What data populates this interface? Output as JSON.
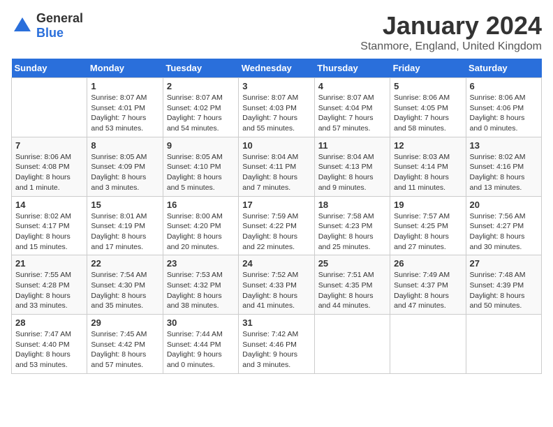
{
  "header": {
    "logo_general": "General",
    "logo_blue": "Blue",
    "month_title": "January 2024",
    "location": "Stanmore, England, United Kingdom"
  },
  "days_of_week": [
    "Sunday",
    "Monday",
    "Tuesday",
    "Wednesday",
    "Thursday",
    "Friday",
    "Saturday"
  ],
  "weeks": [
    [
      {
        "day": "",
        "info": ""
      },
      {
        "day": "1",
        "info": "Sunrise: 8:07 AM\nSunset: 4:01 PM\nDaylight: 7 hours\nand 53 minutes."
      },
      {
        "day": "2",
        "info": "Sunrise: 8:07 AM\nSunset: 4:02 PM\nDaylight: 7 hours\nand 54 minutes."
      },
      {
        "day": "3",
        "info": "Sunrise: 8:07 AM\nSunset: 4:03 PM\nDaylight: 7 hours\nand 55 minutes."
      },
      {
        "day": "4",
        "info": "Sunrise: 8:07 AM\nSunset: 4:04 PM\nDaylight: 7 hours\nand 57 minutes."
      },
      {
        "day": "5",
        "info": "Sunrise: 8:06 AM\nSunset: 4:05 PM\nDaylight: 7 hours\nand 58 minutes."
      },
      {
        "day": "6",
        "info": "Sunrise: 8:06 AM\nSunset: 4:06 PM\nDaylight: 8 hours\nand 0 minutes."
      }
    ],
    [
      {
        "day": "7",
        "info": "Sunrise: 8:06 AM\nSunset: 4:08 PM\nDaylight: 8 hours\nand 1 minute."
      },
      {
        "day": "8",
        "info": "Sunrise: 8:05 AM\nSunset: 4:09 PM\nDaylight: 8 hours\nand 3 minutes."
      },
      {
        "day": "9",
        "info": "Sunrise: 8:05 AM\nSunset: 4:10 PM\nDaylight: 8 hours\nand 5 minutes."
      },
      {
        "day": "10",
        "info": "Sunrise: 8:04 AM\nSunset: 4:11 PM\nDaylight: 8 hours\nand 7 minutes."
      },
      {
        "day": "11",
        "info": "Sunrise: 8:04 AM\nSunset: 4:13 PM\nDaylight: 8 hours\nand 9 minutes."
      },
      {
        "day": "12",
        "info": "Sunrise: 8:03 AM\nSunset: 4:14 PM\nDaylight: 8 hours\nand 11 minutes."
      },
      {
        "day": "13",
        "info": "Sunrise: 8:02 AM\nSunset: 4:16 PM\nDaylight: 8 hours\nand 13 minutes."
      }
    ],
    [
      {
        "day": "14",
        "info": "Sunrise: 8:02 AM\nSunset: 4:17 PM\nDaylight: 8 hours\nand 15 minutes."
      },
      {
        "day": "15",
        "info": "Sunrise: 8:01 AM\nSunset: 4:19 PM\nDaylight: 8 hours\nand 17 minutes."
      },
      {
        "day": "16",
        "info": "Sunrise: 8:00 AM\nSunset: 4:20 PM\nDaylight: 8 hours\nand 20 minutes."
      },
      {
        "day": "17",
        "info": "Sunrise: 7:59 AM\nSunset: 4:22 PM\nDaylight: 8 hours\nand 22 minutes."
      },
      {
        "day": "18",
        "info": "Sunrise: 7:58 AM\nSunset: 4:23 PM\nDaylight: 8 hours\nand 25 minutes."
      },
      {
        "day": "19",
        "info": "Sunrise: 7:57 AM\nSunset: 4:25 PM\nDaylight: 8 hours\nand 27 minutes."
      },
      {
        "day": "20",
        "info": "Sunrise: 7:56 AM\nSunset: 4:27 PM\nDaylight: 8 hours\nand 30 minutes."
      }
    ],
    [
      {
        "day": "21",
        "info": "Sunrise: 7:55 AM\nSunset: 4:28 PM\nDaylight: 8 hours\nand 33 minutes."
      },
      {
        "day": "22",
        "info": "Sunrise: 7:54 AM\nSunset: 4:30 PM\nDaylight: 8 hours\nand 35 minutes."
      },
      {
        "day": "23",
        "info": "Sunrise: 7:53 AM\nSunset: 4:32 PM\nDaylight: 8 hours\nand 38 minutes."
      },
      {
        "day": "24",
        "info": "Sunrise: 7:52 AM\nSunset: 4:33 PM\nDaylight: 8 hours\nand 41 minutes."
      },
      {
        "day": "25",
        "info": "Sunrise: 7:51 AM\nSunset: 4:35 PM\nDaylight: 8 hours\nand 44 minutes."
      },
      {
        "day": "26",
        "info": "Sunrise: 7:49 AM\nSunset: 4:37 PM\nDaylight: 8 hours\nand 47 minutes."
      },
      {
        "day": "27",
        "info": "Sunrise: 7:48 AM\nSunset: 4:39 PM\nDaylight: 8 hours\nand 50 minutes."
      }
    ],
    [
      {
        "day": "28",
        "info": "Sunrise: 7:47 AM\nSunset: 4:40 PM\nDaylight: 8 hours\nand 53 minutes."
      },
      {
        "day": "29",
        "info": "Sunrise: 7:45 AM\nSunset: 4:42 PM\nDaylight: 8 hours\nand 57 minutes."
      },
      {
        "day": "30",
        "info": "Sunrise: 7:44 AM\nSunset: 4:44 PM\nDaylight: 9 hours\nand 0 minutes."
      },
      {
        "day": "31",
        "info": "Sunrise: 7:42 AM\nSunset: 4:46 PM\nDaylight: 9 hours\nand 3 minutes."
      },
      {
        "day": "",
        "info": ""
      },
      {
        "day": "",
        "info": ""
      },
      {
        "day": "",
        "info": ""
      }
    ]
  ]
}
